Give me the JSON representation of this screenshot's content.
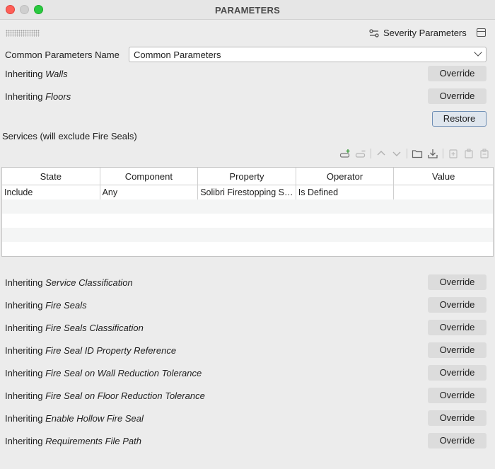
{
  "window": {
    "title": "PARAMETERS"
  },
  "header": {
    "severity_label": "Severity Parameters"
  },
  "common": {
    "label": "Common Parameters Name",
    "selected": "Common Parameters"
  },
  "inherit_prefix": "Inheriting",
  "top_rows": [
    {
      "name": "Walls",
      "button": "Override"
    },
    {
      "name": "Floors",
      "button": "Override"
    }
  ],
  "restore_label": "Restore",
  "services": {
    "label": "Services (will exclude Fire Seals)",
    "columns": [
      "State",
      "Component",
      "Property",
      "Operator",
      "Value"
    ],
    "rows": [
      [
        "Include",
        "Any",
        "Solibri Firestopping Solution",
        "Is Defined",
        ""
      ]
    ]
  },
  "bottom_rows": [
    {
      "name": "Service Classification",
      "button": "Override"
    },
    {
      "name": "Fire Seals",
      "button": "Override"
    },
    {
      "name": "Fire Seals Classification",
      "button": "Override"
    },
    {
      "name": "Fire Seal ID Property Reference",
      "button": "Override"
    },
    {
      "name": "Fire Seal on Wall Reduction Tolerance",
      "button": "Override"
    },
    {
      "name": "Fire Seal on Floor Reduction Tolerance",
      "button": "Override"
    },
    {
      "name": "Enable Hollow Fire Seal",
      "button": "Override"
    },
    {
      "name": "Requirements File Path",
      "button": "Override"
    }
  ]
}
